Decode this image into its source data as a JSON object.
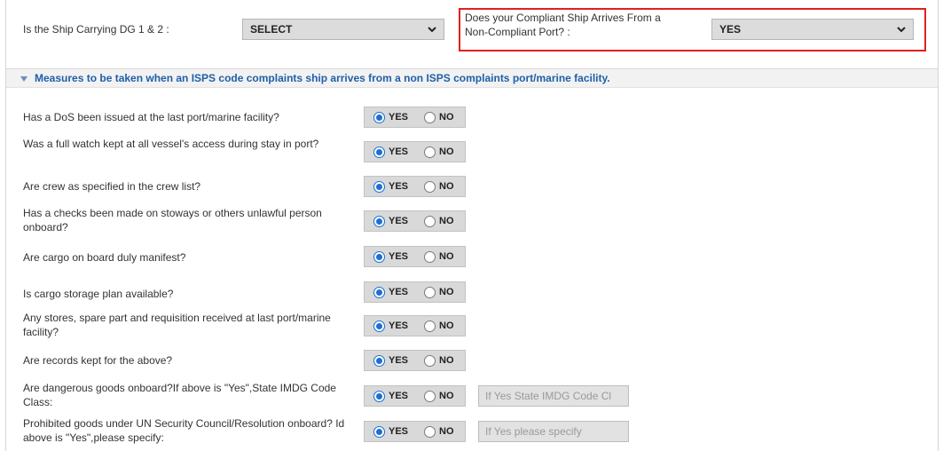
{
  "top": {
    "dg_label": "Is the Ship Carrying DG 1 & 2 :",
    "dg_value": "SELECT",
    "noncompliant_label_line1": "Does your Compliant Ship Arrives From a",
    "noncompliant_label_line2": "Non-Compliant Port? :",
    "noncompliant_value": "YES",
    "highlight_color": "#e02020"
  },
  "section": {
    "title": "Measures to be taken when an ISPS code complaints ship arrives from a non ISPS complaints port/marine facility.",
    "title_color": "#1f5fa8"
  },
  "options": {
    "yes": "YES",
    "no": "NO"
  },
  "questions": [
    {
      "text": "Has a DoS been issued at the last port/marine facility?",
      "selected": "YES"
    },
    {
      "text": "Was a full watch kept at all vessel's access during stay in port?",
      "selected": "YES"
    },
    {
      "text": "Are crew as specified in the crew list?",
      "selected": "YES"
    },
    {
      "text": "Has a checks been made on stoways or others unlawful person onboard?",
      "selected": "YES"
    },
    {
      "text": "Are cargo on board duly manifest?",
      "selected": "YES"
    },
    {
      "text": "Is cargo storage plan available?",
      "selected": "YES"
    },
    {
      "text": "Any stores, spare part and requisition received at last port/marine facility?",
      "selected": "YES"
    },
    {
      "text": "Are records kept for the above?",
      "selected": "YES"
    },
    {
      "text": "Are dangerous goods onboard?If above is \"Yes\",State IMDG Code Class:",
      "selected": "YES",
      "input_placeholder": "If Yes State IMDG Code Cl"
    },
    {
      "text": "Prohibited goods under UN Security Council/Resolution onboard? Id above is \"Yes\",please specify:",
      "selected": "YES",
      "input_placeholder": "If Yes please specify"
    }
  ]
}
